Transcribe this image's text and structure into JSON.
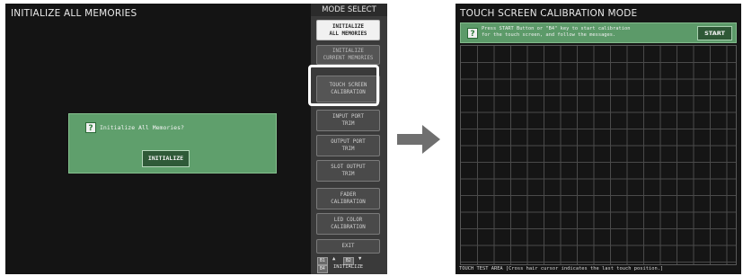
{
  "left_screen": {
    "title": "INITIALIZE ALL MEMORIES",
    "dialog": {
      "icon": "question-icon",
      "icon_glyph": "?",
      "message": "Initialize All Memories?",
      "button_label": "INITIALIZE"
    },
    "mode_select": {
      "header": "MODE SELECT",
      "buttons": [
        {
          "label": "INITIALIZE\nALL MEMORIES"
        },
        {
          "label": "INITIALIZE\nCURRENT MEMORIES"
        },
        {
          "label": "TOUCH SCREEN\nCALIBRATION"
        },
        {
          "label": "INPUT PORT\nTRIM"
        },
        {
          "label": "OUTPUT PORT\nTRIM"
        },
        {
          "label": "SLOT OUTPUT\nTRIM"
        },
        {
          "label": "FADER\nCALIBRATION"
        },
        {
          "label": "LED COLOR\nCALIBRATION"
        },
        {
          "label": "EXIT"
        }
      ],
      "nav": {
        "chip_a": "B1",
        "chip_b": "B2",
        "chip_c": "B4",
        "init_label": "INITIALIZE"
      }
    }
  },
  "arrow_icon": "right-arrow-icon",
  "right_screen": {
    "title": "TOUCH SCREEN CALIBRATION MODE",
    "info": {
      "icon_glyph": "?",
      "message": "Press START Button or \"B4\" key to start calibration\nfor the touch screen, and follow the messages."
    },
    "start_label": "START",
    "footer": "TOUCH TEST AREA  [Cross hair cursor indicates the last touch position.]"
  },
  "colors": {
    "screen_bg": "#141414",
    "dialog_green": "#5f9f6c",
    "button_dark_green": "#2f5a38",
    "grid_line": "#4a4a4a",
    "highlight": "#ffffff"
  }
}
